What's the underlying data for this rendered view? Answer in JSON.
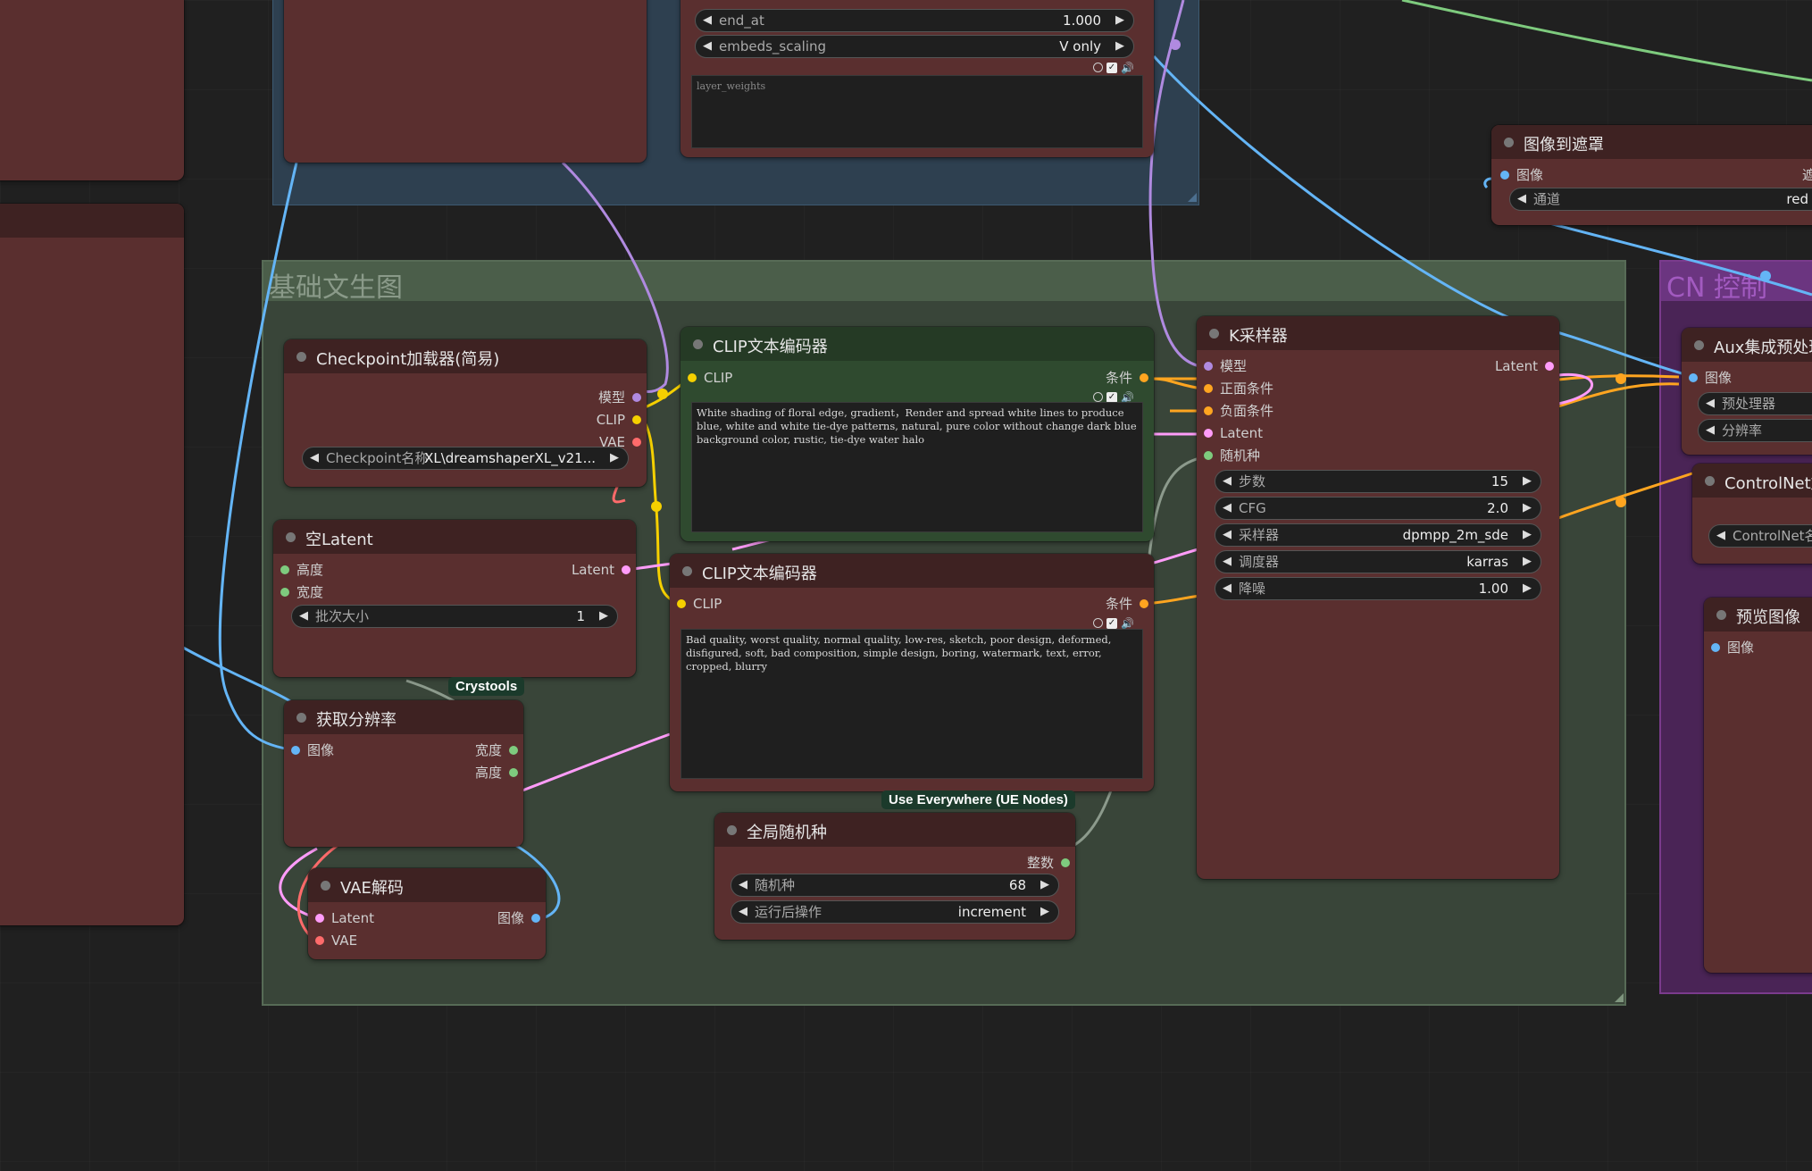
{
  "groups": {
    "basic": {
      "title": "基础文生图"
    },
    "cn": {
      "title": "CN 控制"
    }
  },
  "ipadapter_fragment": {
    "widgets": [
      {
        "label": "end_at",
        "value": "1.000"
      },
      {
        "label": "embeds_scaling",
        "value": "V only"
      }
    ],
    "textarea_placeholder": "layer_weights"
  },
  "image_to_mask": {
    "title": "图像到遮罩",
    "input": "图像",
    "output_partial": "遮",
    "widget": {
      "label": "通道",
      "value": "red"
    }
  },
  "checkpoint": {
    "title": "Checkpoint加载器(简易)",
    "outputs": [
      "模型",
      "CLIP",
      "VAE"
    ],
    "widget": {
      "label": "Checkpoint名称",
      "value": "XL\\dreamshaperXL_v21..."
    }
  },
  "clip_pos": {
    "title": "CLIP文本编码器",
    "input": "CLIP",
    "output": "条件",
    "text": "White shading of floral edge, gradient，Render and spread white lines to produce blue, white and white tie-dye patterns, natural, pure color without change dark blue background color, rustic, tie-dye water halo"
  },
  "clip_neg": {
    "title": "CLIP文本编码器",
    "input": "CLIP",
    "output": "条件",
    "text": "Bad quality, worst quality, normal quality, low-res, sketch, poor design, deformed, disfigured, soft, bad composition, simple design, boring, watermark, text, error, cropped, blurry"
  },
  "empty_latent": {
    "title": "空Latent",
    "inputs": [
      "高度",
      "宽度"
    ],
    "output": "Latent",
    "widget": {
      "label": "批次大小",
      "value": "1"
    }
  },
  "get_resolution": {
    "title": "获取分辨率",
    "input": "图像",
    "outputs": [
      "宽度",
      "高度"
    ],
    "badge": "Crystools"
  },
  "vae_decode": {
    "title": "VAE解码",
    "inputs": [
      "Latent",
      "VAE"
    ],
    "output": "图像"
  },
  "ksampler": {
    "title": "K采样器",
    "inputs": [
      "模型",
      "正面条件",
      "负面条件",
      "Latent",
      "随机种"
    ],
    "output": "Latent",
    "widgets": [
      {
        "label": "步数",
        "value": "15"
      },
      {
        "label": "CFG",
        "value": "2.0"
      },
      {
        "label": "采样器",
        "value": "dpmpp_2m_sde"
      },
      {
        "label": "调度器",
        "value": "karras"
      },
      {
        "label": "降噪",
        "value": "1.00"
      }
    ]
  },
  "global_seed": {
    "title": "全局随机种",
    "badge": "Use Everywhere (UE Nodes)",
    "output": "整数",
    "widgets": [
      {
        "label": "随机种",
        "value": "68"
      },
      {
        "label": "运行后操作",
        "value": "increment"
      }
    ]
  },
  "aux_preprocessor": {
    "title": "Aux集成预处理",
    "input": "图像",
    "widgets": [
      {
        "label": "预处理器"
      },
      {
        "label": "分辨率"
      }
    ]
  },
  "controlnet_loader": {
    "title": "ControlNet加",
    "widget": {
      "label": "ControlNet名"
    }
  },
  "preview_image": {
    "title": "预览图像",
    "input": "图像"
  },
  "colors": {
    "canvas": "#202020",
    "node_body": "#5a2f2f",
    "node_head": "#3e2222",
    "green_node": "#2f4a2f",
    "group_basic": "#3b4a3a",
    "group_blue": "#2e4050",
    "group_cn": "#5a2a66",
    "link_model": "#b08ae0",
    "link_clip": "#f5d000",
    "link_vae": "#ff6b6b",
    "link_cond": "#ffa520",
    "link_latent": "#ff9cf9",
    "link_image": "#64b5f6",
    "link_int": "#7ecb7e"
  }
}
